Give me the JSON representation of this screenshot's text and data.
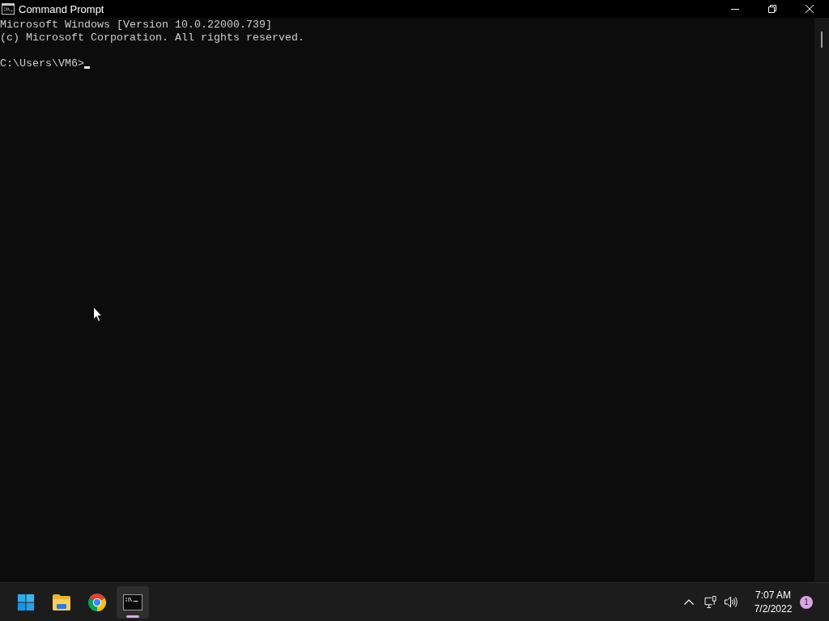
{
  "window": {
    "title": "Command Prompt"
  },
  "console": {
    "banner": [
      "Microsoft Windows [Version 10.0.22000.739]",
      "(c) Microsoft Corporation. All rights reserved."
    ],
    "prompt": "C:\\Users\\VM6>"
  },
  "taskbar": {
    "pinned": [
      {
        "kind": "start",
        "selected": false
      },
      {
        "kind": "folder",
        "selected": false
      },
      {
        "kind": "browser",
        "selected": false
      },
      {
        "kind": "terminal",
        "selected": true
      }
    ],
    "clock": {
      "time": "7:07 AM",
      "date": "7/2/2022"
    },
    "notifications": {
      "count": "1"
    }
  }
}
